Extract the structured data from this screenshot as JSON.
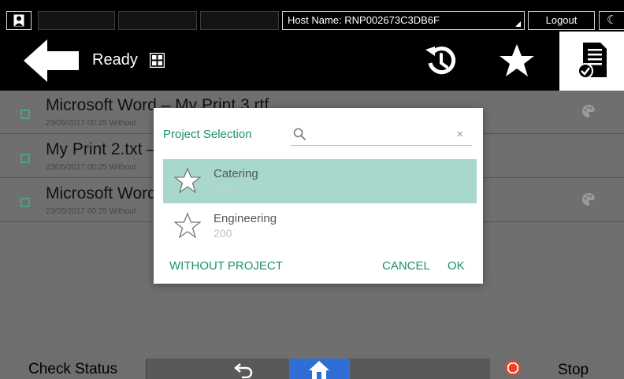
{
  "topbar": {
    "host_label": "Host Name: RNP002673C3DB6F",
    "logout_label": "Logout",
    "icons": {
      "user": "user-icon",
      "night_mode": "moon-icon"
    }
  },
  "header": {
    "status_label": "Ready",
    "icons": [
      "back-arrow-icon",
      "grid-icon",
      "history-icon",
      "star-icon",
      "document-check-icon"
    ]
  },
  "print_jobs": [
    {
      "title": "Microsoft Word – My Print 3.rtf",
      "details": "23/05/2017 00:25 Without"
    },
    {
      "title": "My Print 2.txt –",
      "details": "23/05/2017 00:25 Without"
    },
    {
      "title": "Microsoft Word",
      "details": "23/05/2017 00:25 Without"
    }
  ],
  "dialog": {
    "title": "Project Selection",
    "search_value": "",
    "search_placeholder": "",
    "clear_symbol": "×",
    "projects": [
      {
        "name": "Catering",
        "number": "100",
        "selected": true
      },
      {
        "name": "Engineering",
        "number": "200",
        "selected": false
      }
    ],
    "without_project_label": "WITHOUT PROJECT",
    "cancel_label": "CANCEL",
    "ok_label": "OK"
  },
  "bottombar": {
    "check_status_label": "Check Status",
    "stop_label": "Stop",
    "icons": [
      "return-icon",
      "home-icon",
      "stop-icon"
    ]
  },
  "colors": {
    "accent": "#1d8f70",
    "selected_row": "#a7d8cb",
    "home_button": "#2f6fd5",
    "stop_icon": "#e8452c",
    "checkbox": "#4aa37f",
    "list_background": "#6f6f6f"
  }
}
